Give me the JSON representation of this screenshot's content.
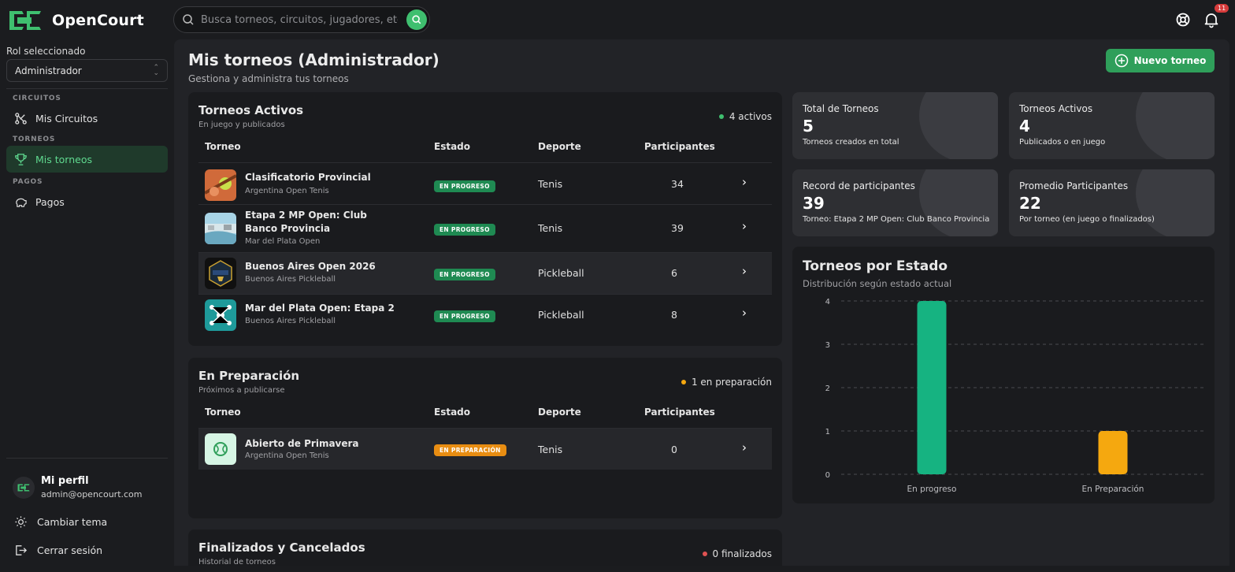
{
  "app": {
    "name": "OpenCourt"
  },
  "search": {
    "placeholder": "Busca torneos, circuitos, jugadores, etc."
  },
  "notifications": {
    "count": "11"
  },
  "sidebar": {
    "role_label": "Rol seleccionado",
    "role_value": "Administrador",
    "sections": [
      {
        "title": "CIRCUITOS",
        "item": "Mis Circuitos"
      },
      {
        "title": "TORNEOS",
        "item": "Mis torneos"
      },
      {
        "title": "PAGOS",
        "item": "Pagos"
      }
    ],
    "profile": {
      "name": "Mi perfil",
      "email": "admin@opencourt.com"
    },
    "actions": {
      "theme": "Cambiar tema",
      "logout": "Cerrar sesión"
    }
  },
  "header": {
    "title": "Mis torneos (Administrador)",
    "subtitle": "Gestiona y administra tus torneos",
    "new_button": "Nuevo torneo"
  },
  "table_headers": [
    "Torneo",
    "Estado",
    "Deporte",
    "Participantes"
  ],
  "active": {
    "title": "Torneos Activos",
    "subtitle": "En juego y publicados",
    "count": "4 activos",
    "rows": [
      {
        "name": "Clasificatorio Provincial",
        "circuit": "Argentina Open Tenis",
        "status": "EN PROGRESO",
        "sport": "Tenis",
        "participants": "34"
      },
      {
        "name": "Etapa 2 MP Open: Club Banco Provincia",
        "circuit": "Mar del Plata Open",
        "status": "EN PROGRESO",
        "sport": "Tenis",
        "participants": "39"
      },
      {
        "name": "Buenos Aires Open 2026",
        "circuit": "Buenos Aires Pickleball",
        "status": "EN PROGRESO",
        "sport": "Pickleball",
        "participants": "6"
      },
      {
        "name": "Mar del Plata Open: Etapa 2",
        "circuit": "Buenos Aires Pickleball",
        "status": "EN PROGRESO",
        "sport": "Pickleball",
        "participants": "8"
      }
    ]
  },
  "preparation": {
    "title": "En Preparación",
    "subtitle": "Próximos a publicarse",
    "count": "1 en preparación",
    "rows": [
      {
        "name": "Abierto de Primavera",
        "circuit": "Argentina Open Tenis",
        "status": "EN PREPARACIÓN",
        "sport": "Tenis",
        "participants": "0"
      }
    ]
  },
  "finished": {
    "title": "Finalizados y Cancelados",
    "subtitle": "Historial de torneos",
    "count": "0 finalizados"
  },
  "stats": [
    {
      "label": "Total de Torneos",
      "value": "5",
      "sub": "Torneos creados en total"
    },
    {
      "label": "Torneos Activos",
      "value": "4",
      "sub": "Publicados o en juego"
    },
    {
      "label": "Record de participantes",
      "value": "39",
      "sub": "Torneo: Etapa 2 MP Open: Club Banco Provincia"
    },
    {
      "label": "Promedio Participantes",
      "value": "22",
      "sub": "Por torneo (en juego o finalizados)"
    }
  ],
  "colors": {
    "accent": "#2f9f5a",
    "progress": "#1f8a52",
    "preparation": "#e88d12",
    "finished": "#e05252"
  },
  "chart_data": {
    "type": "bar",
    "title": "Torneos por Estado",
    "subtitle": "Distribución según estado actual",
    "categories": [
      "En progreso",
      "En Preparación"
    ],
    "values": [
      4,
      1
    ],
    "colors": [
      "#16b381",
      "#f5a80f"
    ],
    "yticks": [
      0,
      1,
      2,
      3,
      4
    ],
    "ylim": [
      0,
      4
    ],
    "grid": true
  }
}
